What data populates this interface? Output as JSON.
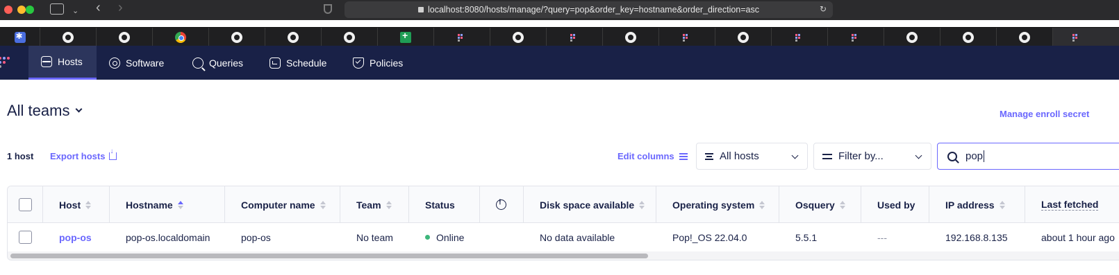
{
  "browser": {
    "url": "localhost:8080/hosts/manage/?query=pop&order_key=hostname&order_direction=asc"
  },
  "nav": {
    "items": [
      {
        "label": "Hosts",
        "icon": "hosts-icon",
        "active": true
      },
      {
        "label": "Software",
        "icon": "software-icon"
      },
      {
        "label": "Queries",
        "icon": "queries-icon"
      },
      {
        "label": "Schedule",
        "icon": "schedule-icon"
      },
      {
        "label": "Policies",
        "icon": "policies-icon"
      }
    ]
  },
  "page": {
    "team_title": "All teams",
    "manage_link": "Manage enroll secret",
    "host_count": "1 host",
    "export_label": "Export hosts",
    "edit_columns_label": "Edit columns",
    "status_filter": "All hosts",
    "filter_label": "Filter by...",
    "search_value": "pop"
  },
  "table": {
    "headers": {
      "host": "Host",
      "hostname": "Hostname",
      "computer_name": "Computer name",
      "team": "Team",
      "status": "Status",
      "disk_space": "Disk space available",
      "os": "Operating system",
      "osquery": "Osquery",
      "used_by": "Used by",
      "ip": "IP address",
      "last_fetched": "Last fetched"
    },
    "rows": [
      {
        "host": "pop-os",
        "hostname": "pop-os.localdomain",
        "computer_name": "pop-os",
        "team": "No team",
        "status": "Online",
        "disk_space": "No data available",
        "os": "Pop!_OS 22.04.0",
        "osquery": "5.5.1",
        "used_by": "---",
        "ip": "192.168.8.135",
        "last_fetched": "about 1 hour ago"
      }
    ]
  },
  "colors": {
    "nav_bg": "#192147",
    "accent": "#6a67fe",
    "online": "#3db67b"
  }
}
